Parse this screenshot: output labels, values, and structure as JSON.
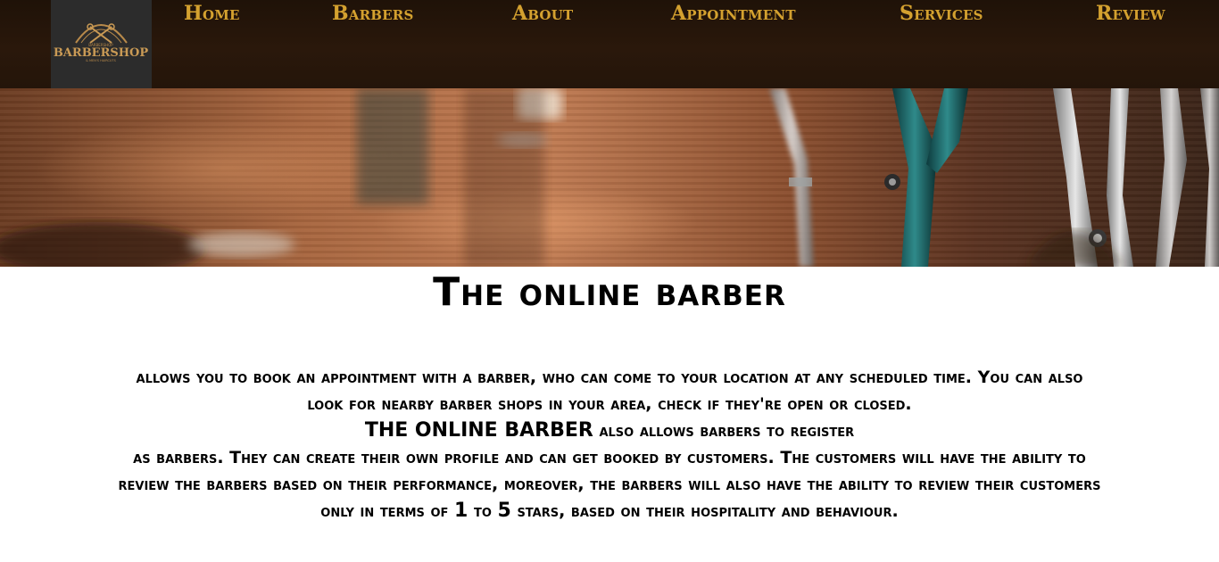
{
  "logo": {
    "text": "BARBERSHOP",
    "small_top": "BARBERSHOP",
    "small_bottom": "& MEN'S HAIRCUTS",
    "icon": "scissors-logo-icon"
  },
  "nav": {
    "items": [
      {
        "label": "Home"
      },
      {
        "label": "Barbers"
      },
      {
        "label": "About"
      },
      {
        "label": "Appointment"
      },
      {
        "label": "Services"
      },
      {
        "label": "Review"
      }
    ]
  },
  "main": {
    "title": "The online barber",
    "line1": "allows you to book an appointment with a barber, who can come to your location at any scheduled time. You can also",
    "line2": "look for nearby barber shops in your area, check if they're open or closed.",
    "brand_inline": "THE ONLINE BARBER",
    "line3_rest": " also allows barbers to register",
    "line4": "as barbers. They can create their own profile and can get booked by customers. The customers will have the ability to",
    "line5": "review the barbers based on their performance, moreover, the barbers will also have the ability to review their customers",
    "line6_pre": "only in terms of ",
    "line6_one": "1",
    "line6_mid": " to ",
    "line6_five": "5",
    "line6_post": " stars, based on their hospitality and behaviour."
  },
  "colors": {
    "nav_text": "#d4a12f",
    "topbar_bg": "#24150a",
    "logo_bg": "#2c2c2c"
  }
}
